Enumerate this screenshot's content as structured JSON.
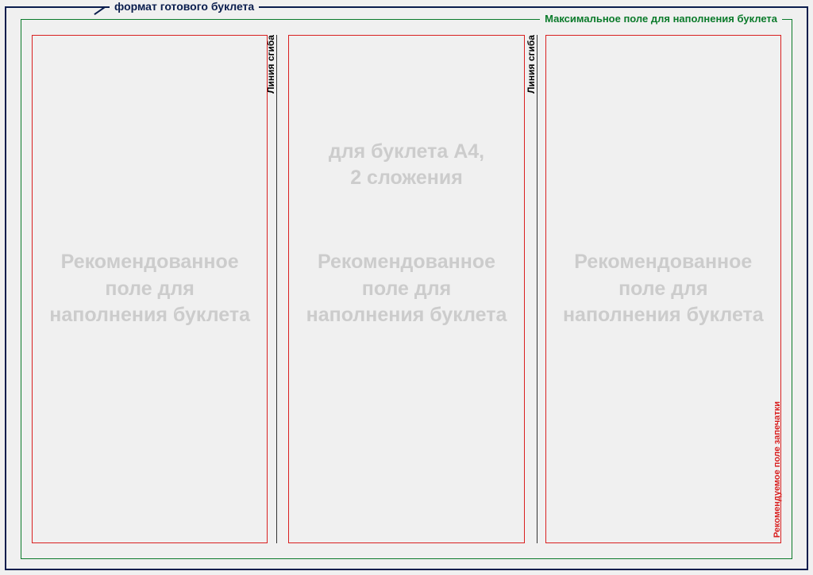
{
  "labels": {
    "outer_frame": "формат готового буклета",
    "inner_frame": "Максимальное поле для наполнения буклета",
    "fold_line": "Линия сгиба",
    "print_area": "Рекомендуемое поле запечатки"
  },
  "subtitle": "для буклета А4,\n2 сложения",
  "panel_text": "Рекомендованное поле для наполнения буклета",
  "colors": {
    "outer_border": "#0a1d4d",
    "inner_border": "#0a7a2a",
    "panel_border": "#d92020",
    "watermark": "#cccccc"
  }
}
